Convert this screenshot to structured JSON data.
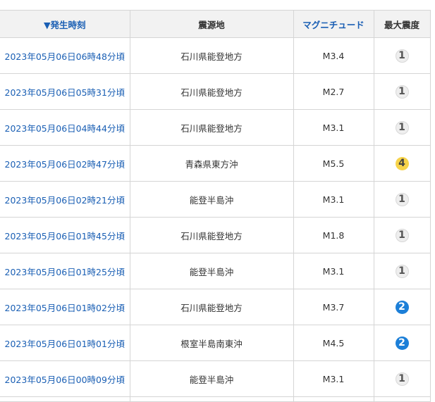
{
  "headers": {
    "time": "▼発生時刻",
    "place": "震源地",
    "magnitude": "マグニチュード",
    "intensity": "最大震度"
  },
  "rows": [
    {
      "time": "2023年05月06日06時48分頃",
      "place": "石川県能登地方",
      "magnitude": "M3.4",
      "intensity": "1"
    },
    {
      "time": "2023年05月06日05時31分頃",
      "place": "石川県能登地方",
      "magnitude": "M2.7",
      "intensity": "1"
    },
    {
      "time": "2023年05月06日04時44分頃",
      "place": "石川県能登地方",
      "magnitude": "M3.1",
      "intensity": "1"
    },
    {
      "time": "2023年05月06日02時47分頃",
      "place": "青森県東方沖",
      "magnitude": "M5.5",
      "intensity": "4"
    },
    {
      "time": "2023年05月06日02時21分頃",
      "place": "能登半島沖",
      "magnitude": "M3.1",
      "intensity": "1"
    },
    {
      "time": "2023年05月06日01時45分頃",
      "place": "石川県能登地方",
      "magnitude": "M1.8",
      "intensity": "1"
    },
    {
      "time": "2023年05月06日01時25分頃",
      "place": "能登半島沖",
      "magnitude": "M3.1",
      "intensity": "1"
    },
    {
      "time": "2023年05月06日01時02分頃",
      "place": "石川県能登地方",
      "magnitude": "M3.7",
      "intensity": "2"
    },
    {
      "time": "2023年05月06日01時01分頃",
      "place": "根室半島南東沖",
      "magnitude": "M4.5",
      "intensity": "2"
    },
    {
      "time": "2023年05月06日00時09分頃",
      "place": "能登半島沖",
      "magnitude": "M3.1",
      "intensity": "1"
    }
  ],
  "intensity_colors": {
    "1": "#eeeeee",
    "2": "#1c7fd8",
    "4": "#f7d34a"
  }
}
